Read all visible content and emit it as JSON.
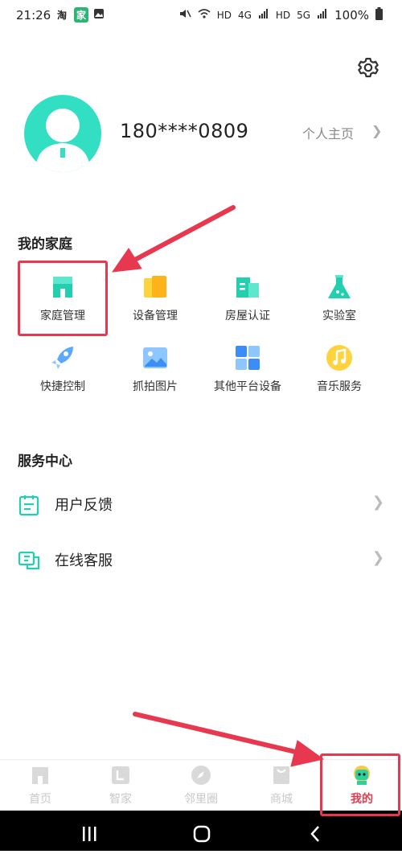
{
  "status_bar": {
    "time": "21:26",
    "app_icon_1": "淘",
    "app_icon_2": "家",
    "net_1": "HD",
    "net_2": "4G",
    "net_3": "HD",
    "net_4": "5G",
    "battery": "100%"
  },
  "profile": {
    "phone": "180****0809",
    "home_link": "个人主页"
  },
  "my_home": {
    "title": "我的家庭",
    "items": [
      {
        "label": "家庭管理",
        "icon": "house-icon"
      },
      {
        "label": "设备管理",
        "icon": "device-icon"
      },
      {
        "label": "房屋认证",
        "icon": "building-icon"
      },
      {
        "label": "实验室",
        "icon": "flask-icon"
      },
      {
        "label": "快捷控制",
        "icon": "rocket-icon"
      },
      {
        "label": "抓拍图片",
        "icon": "picture-icon"
      },
      {
        "label": "其他平台设备",
        "icon": "grid-icon"
      },
      {
        "label": "音乐服务",
        "icon": "music-icon"
      }
    ]
  },
  "service_center": {
    "title": "服务中心",
    "items": [
      {
        "label": "用户反馈",
        "icon": "feedback-icon"
      },
      {
        "label": "在线客服",
        "icon": "chat-icon"
      }
    ]
  },
  "tabs": [
    {
      "label": "首页",
      "icon": "home-tab-icon"
    },
    {
      "label": "智家",
      "icon": "smart-home-tab-icon"
    },
    {
      "label": "邻里圈",
      "icon": "compass-tab-icon"
    },
    {
      "label": "商城",
      "icon": "shop-tab-icon"
    },
    {
      "label": "我的",
      "icon": "me-tab-icon"
    }
  ],
  "colors": {
    "accent": "#33dfc3",
    "active_tab": "#e23b4f",
    "annotation": "#e8384f"
  }
}
